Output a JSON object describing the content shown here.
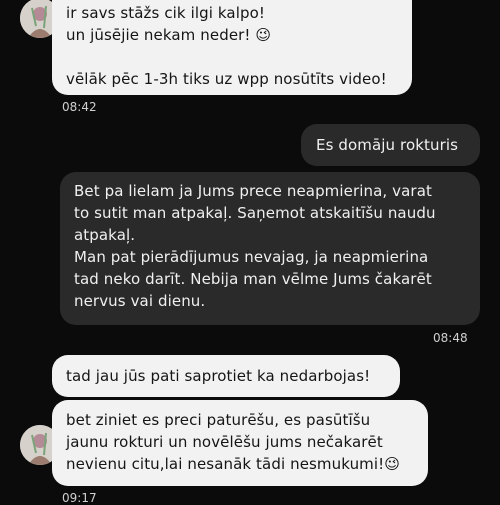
{
  "messages": [
    {
      "lines": [
        "ir savs stāžs cik ilgi kalpo!",
        "un jūsējie nekam neder! 😉",
        "",
        "vēlāk pēc 1-3h tiks uz wpp nosūtīts video!"
      ],
      "time": "08:42"
    },
    {
      "lines": [
        "Es domāju rokturis"
      ]
    },
    {
      "lines": [
        "Bet pa lielam ja Jums prece neapmierina, varat",
        "to sutit man atpakaļ. Saņemot atskaitīšu naudu",
        "atpakaļ.",
        "Man pat pierādījumus nevajag, ja neapmierina",
        "tad neko darīt. Nebija man vēlme Jums čakarēt",
        "nervus vai dienu."
      ],
      "time": "08:48"
    },
    {
      "lines": [
        "tad jau jūs pati saprotiet ka nedarbojas!"
      ]
    },
    {
      "lines": [
        "bet ziniet es preci paturēšu, es pasūtīšu",
        "jaunu rokturi un novēlēšu jums nečakarēt",
        "nevienu citu,lai nesanāk tādi nesmukumi!😉"
      ],
      "time": "09:17"
    }
  ]
}
